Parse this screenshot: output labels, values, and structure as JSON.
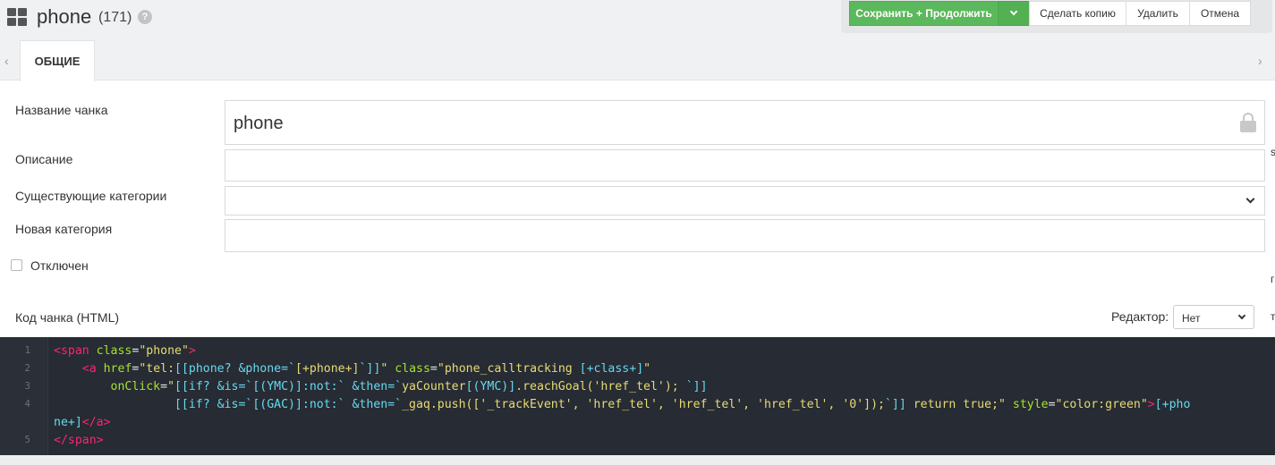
{
  "header": {
    "title": "phone",
    "count": "(171)",
    "help_glyph": "?",
    "icon": "grid-icon"
  },
  "actions": {
    "save_continue": "Сохранить + Продолжить",
    "make_copy": "Сделать копию",
    "delete": "Удалить",
    "cancel": "Отмена",
    "save_color": "#5cb85c"
  },
  "tabs": {
    "left_arrow": "‹",
    "right_arrow": "›",
    "items": [
      {
        "label": "ОБЩИЕ",
        "active": true
      }
    ]
  },
  "form": {
    "name_label": "Название чанка",
    "name_value": "phone",
    "description_label": "Описание",
    "description_value": "",
    "existing_categories_label": "Существующие категории",
    "existing_categories_value": "",
    "new_category_label": "Новая категория",
    "new_category_value": "",
    "disabled_label": "Отключен",
    "disabled_checked": false,
    "code_label": "Код чанка (HTML)",
    "editor_label": "Редактор:",
    "editor_value": "Нет"
  },
  "side_marks": [
    "s",
    "г",
    "т"
  ],
  "code": {
    "line_numbers": [
      "1",
      "2",
      "3",
      "4",
      "",
      "5"
    ],
    "lines": [
      [
        [
          "t",
          "<span"
        ],
        [
          "p",
          " "
        ],
        [
          "a",
          "class"
        ],
        [
          "p",
          "="
        ],
        [
          "s",
          "\"phone\""
        ],
        [
          "t",
          ">"
        ]
      ],
      [
        [
          "p",
          "    "
        ],
        [
          "t",
          "<a"
        ],
        [
          "p",
          " "
        ],
        [
          "a",
          "href"
        ],
        [
          "p",
          "="
        ],
        [
          "s",
          "\"tel:"
        ],
        [
          "m",
          "[[phone? &phone=`"
        ],
        [
          "s",
          "[+phone+]"
        ],
        [
          "m",
          "`]]"
        ],
        [
          "s",
          "\""
        ],
        [
          "p",
          " "
        ],
        [
          "a",
          "class"
        ],
        [
          "p",
          "="
        ],
        [
          "s",
          "\"phone_calltracking "
        ],
        [
          "m",
          "[+class+]"
        ],
        [
          "s",
          "\""
        ]
      ],
      [
        [
          "p",
          "        "
        ],
        [
          "a",
          "onClick"
        ],
        [
          "p",
          "="
        ],
        [
          "s",
          "\""
        ],
        [
          "m",
          "[[if? &is=`[(YMC)]:not:` &then=`"
        ],
        [
          "s",
          "yaCounter"
        ],
        [
          "m",
          "[(YMC)]"
        ],
        [
          "s",
          ".reachGoal('href_tel'); "
        ],
        [
          "m",
          "`]]"
        ]
      ],
      [
        [
          "p",
          "                 "
        ],
        [
          "m",
          "[[if? &is=`[(GAC)]:not:` &then=`"
        ],
        [
          "s",
          "_gaq.push(['_trackEvent', 'href_tel', 'href_tel', 'href_tel', '0']);"
        ],
        [
          "m",
          "`]]"
        ],
        [
          "s",
          " return true;\""
        ],
        [
          "p",
          " "
        ],
        [
          "a",
          "style"
        ],
        [
          "p",
          "="
        ],
        [
          "s",
          "\"color:green\""
        ],
        [
          "t",
          ">"
        ],
        [
          "m",
          "[+pho"
        ]
      ],
      [
        [
          "m",
          "ne+]"
        ],
        [
          "t",
          "</a>"
        ]
      ],
      [
        [
          "t",
          "</span>"
        ]
      ]
    ]
  }
}
